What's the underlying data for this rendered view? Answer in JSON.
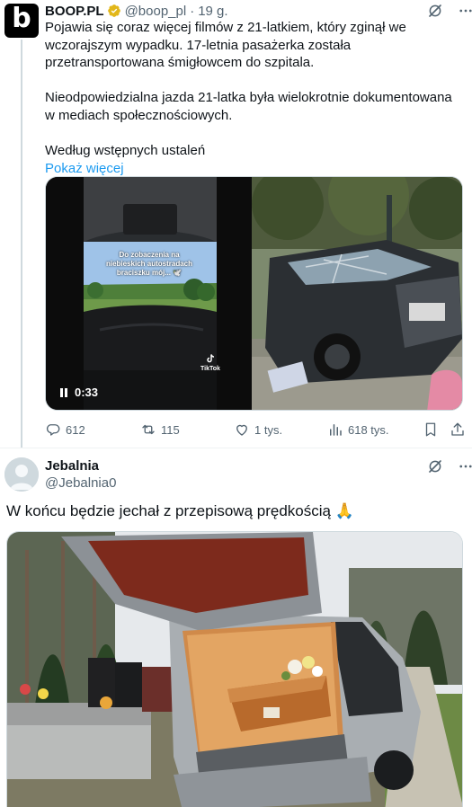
{
  "tweet1": {
    "avatar_letter": "b",
    "author_name": "BOOP.PL",
    "handle": "@boop_pl",
    "separator": "·",
    "time": "19 g.",
    "paragraph1": "Pojawia się coraz więcej filmów z 21-latkiem, który zginął we wczorajszym wypadku. 17-letnia pasażerka została przetransportowana śmigłowcem do szpitala.",
    "paragraph2": "Nieodpowiedzialna jazda 21-latka była wielokrotnie dokumentowana w mediach społecznościowych.",
    "paragraph3": "Według wstępnych ustaleń",
    "show_more": "Pokaż więcej",
    "video": {
      "duration": "0:33",
      "overlay_caption": "Do zobaczenia na niebieskich autostradach braciszku mój... 🕊️",
      "tiktok_tag": "TikTok"
    },
    "actions": {
      "replies": "612",
      "reposts": "115",
      "likes": "1 tys.",
      "views": "618 tys."
    }
  },
  "tweet2": {
    "author_name": "Jebalnia",
    "handle": "@Jebalnia0",
    "text": "W końcu będzie jechał z przepisową prędkością 🙏"
  },
  "colors": {
    "text": "#0f1419",
    "secondary": "#536471",
    "link": "#1d9bf0",
    "verified_gold": "#e2b719",
    "border": "#cfd9de"
  },
  "icons": [
    "grok-icon",
    "more-icon",
    "verified-badge-icon",
    "reply-icon",
    "repost-icon",
    "like-icon",
    "views-icon",
    "bookmark-icon",
    "share-icon",
    "pause-icon",
    "tiktok-icon"
  ]
}
